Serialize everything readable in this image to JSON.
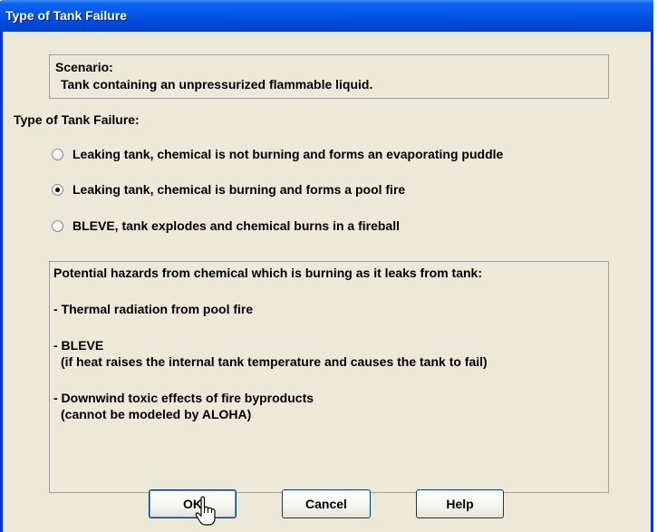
{
  "window": {
    "title": "Type of Tank Failure"
  },
  "scenario": {
    "heading": "Scenario:",
    "description": "Tank containing an unpressurized flammable liquid."
  },
  "failure_type": {
    "label": "Type of Tank Failure:",
    "options": [
      {
        "label": "Leaking tank, chemical is not burning and forms an evaporating puddle",
        "selected": false
      },
      {
        "label": "Leaking tank, chemical is burning and forms a pool fire",
        "selected": true
      },
      {
        "label": "BLEVE, tank explodes and chemical burns in a fireball",
        "selected": false
      }
    ]
  },
  "hazards": {
    "heading": "Potential hazards from chemical which is burning as it leaks from tank:",
    "items": [
      {
        "line1": "- Thermal radiation from pool fire"
      },
      {
        "line1": "- BLEVE",
        "line2": "(if heat raises the internal tank temperature and causes the tank to fail)"
      },
      {
        "line1": "- Downwind toxic effects of fire byproducts",
        "line2": "(cannot be modeled by ALOHA)"
      }
    ]
  },
  "buttons": {
    "ok": "OK",
    "cancel": "Cancel",
    "help": "Help"
  }
}
